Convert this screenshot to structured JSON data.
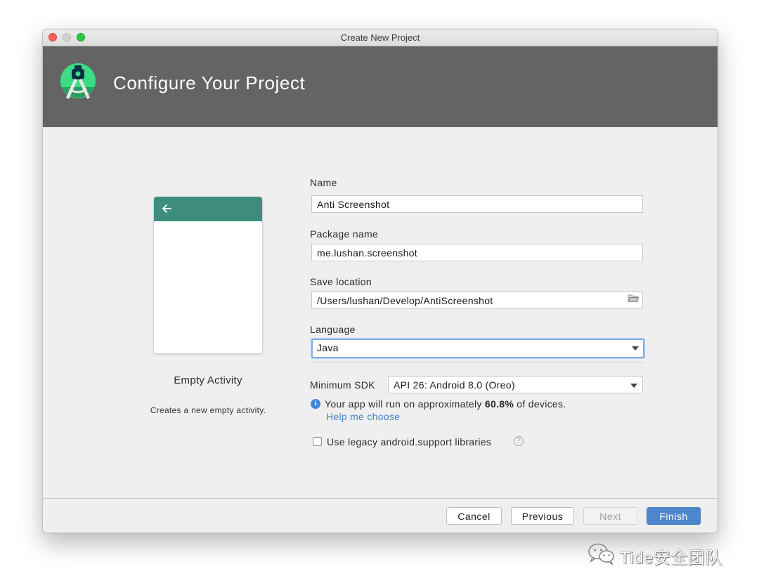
{
  "window": {
    "title": "Create New Project"
  },
  "header": {
    "title": "Configure Your Project"
  },
  "template": {
    "name": "Empty Activity",
    "description": "Creates a new empty activity."
  },
  "form": {
    "name_label": "Name",
    "name_value": "Anti Screenshot",
    "package_label": "Package name",
    "package_value": "me.lushan.screenshot",
    "location_label": "Save location",
    "location_value": "/Users/lushan/Develop/AntiScreenshot",
    "language_label": "Language",
    "language_value": "Java",
    "min_sdk_label": "Minimum SDK",
    "min_sdk_value": "API 26: Android 8.0 (Oreo)",
    "info_prefix": "Your app will run on approximately ",
    "info_percent": "60.8%",
    "info_suffix": " of devices.",
    "help_link": "Help me choose",
    "legacy_label": "Use legacy android.support libraries",
    "legacy_checked": false
  },
  "buttons": {
    "cancel": "Cancel",
    "previous": "Previous",
    "next": "Next",
    "finish": "Finish"
  },
  "watermark": {
    "text": "Tide安全团队"
  },
  "colors": {
    "header_bg": "#646464",
    "activity_bar": "#3d8c7c",
    "primary_button": "#4f87cc",
    "link": "#3f7fc6",
    "focus_ring": "#80aee6"
  },
  "icons": [
    "android-studio-logo",
    "back-arrow-icon",
    "folder-icon",
    "chevron-down-icon",
    "info-icon",
    "help-icon",
    "wechat-icon"
  ]
}
